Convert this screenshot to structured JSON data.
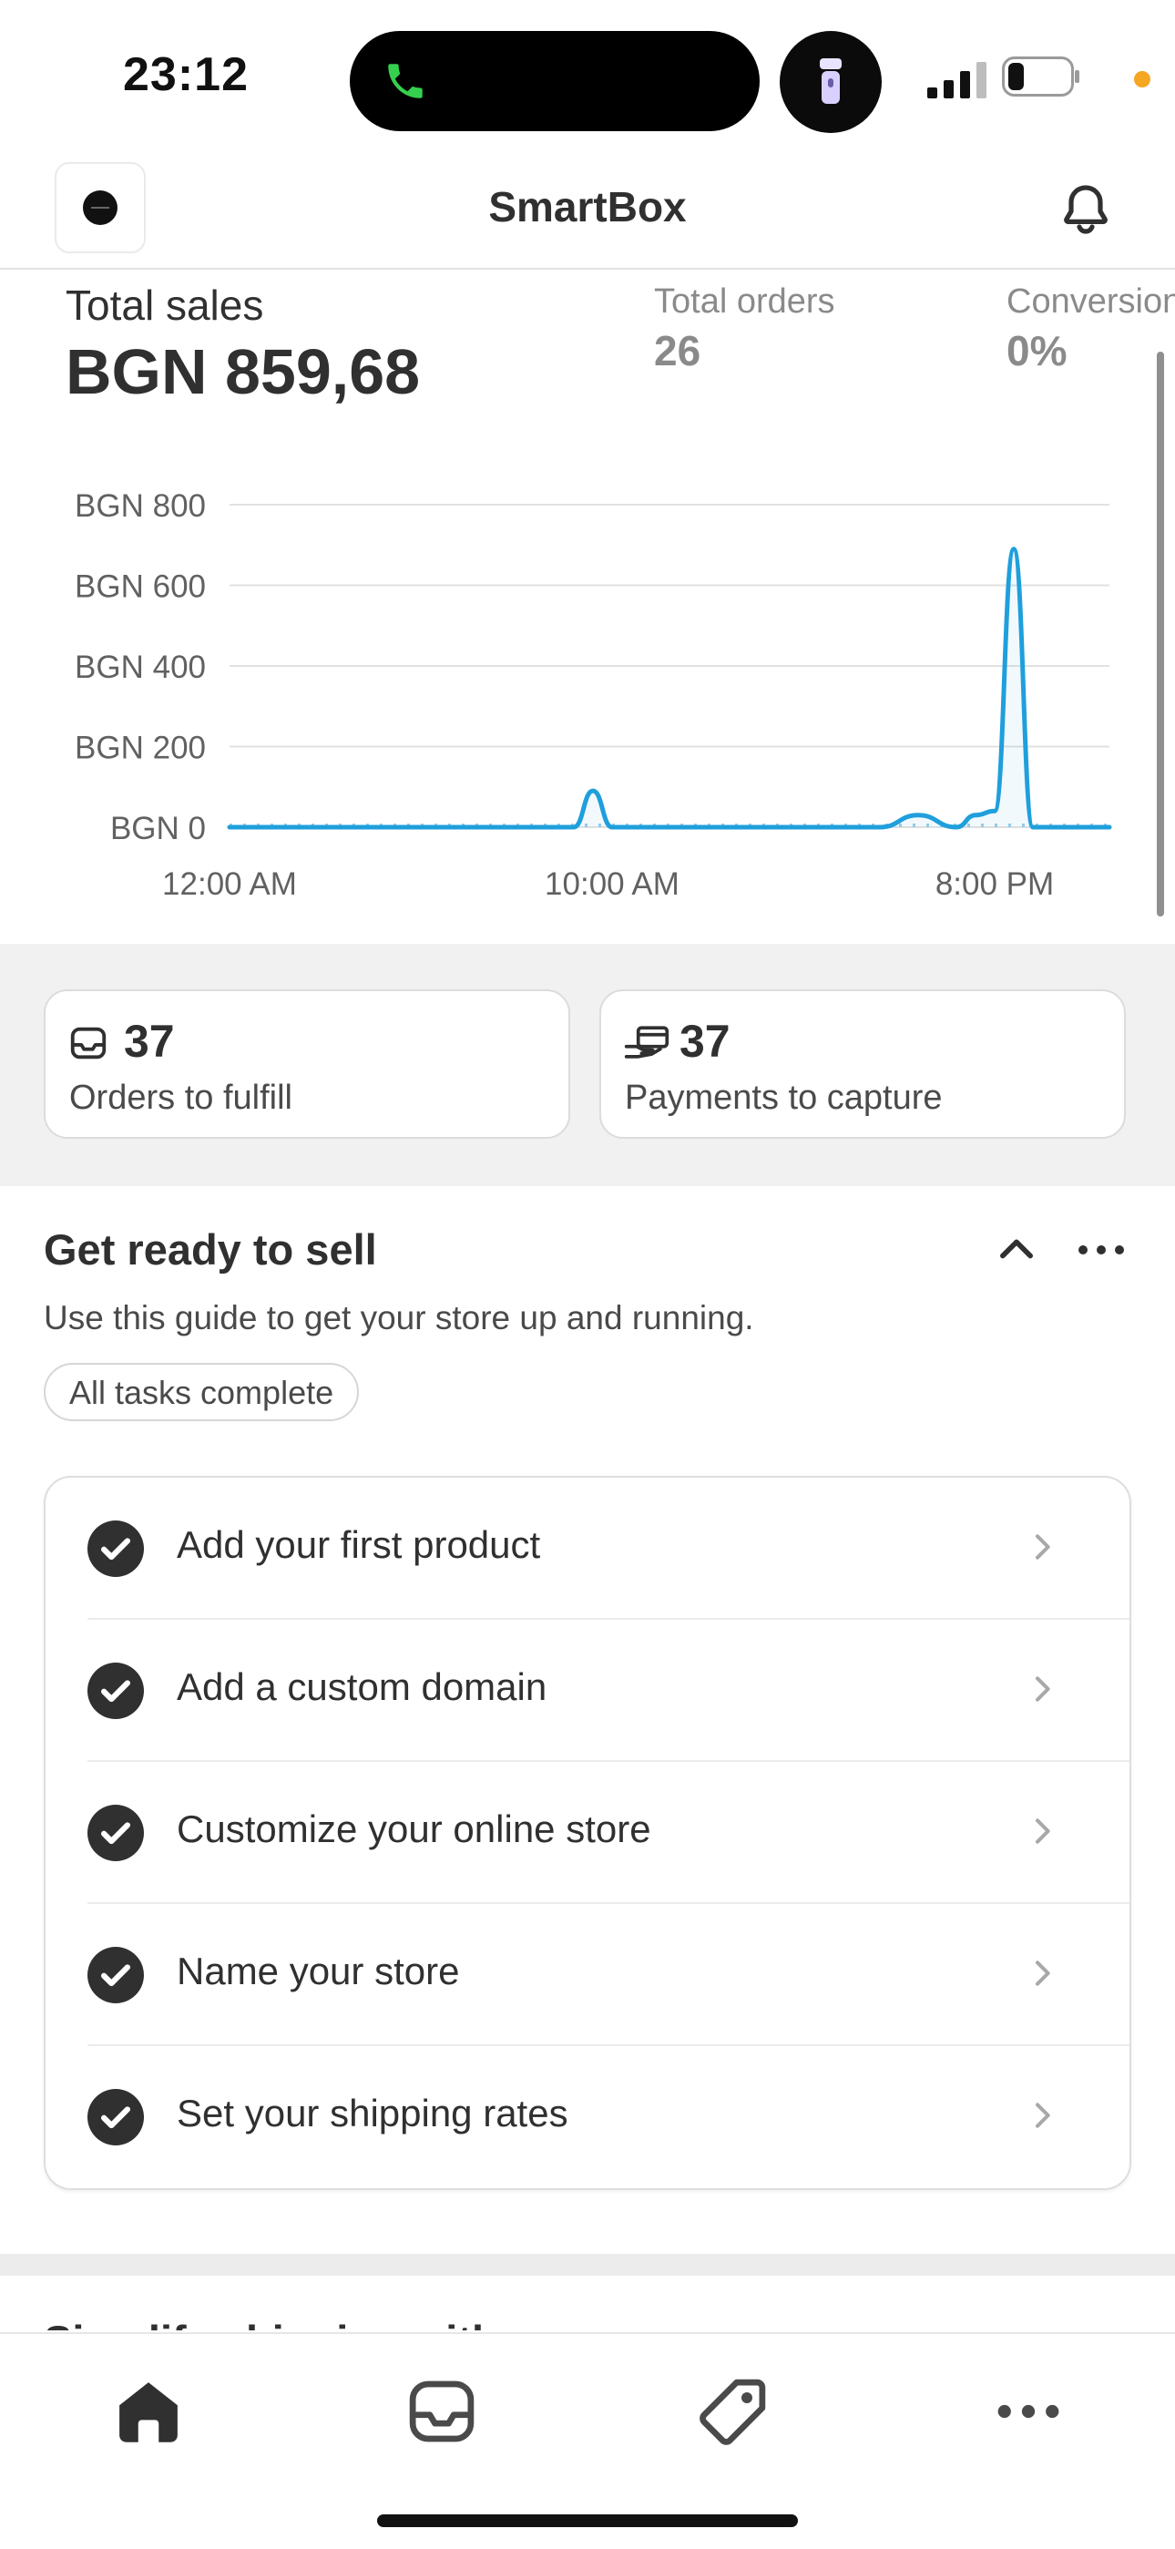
{
  "status_bar": {
    "time": "23:12",
    "battery_level": 0.25
  },
  "header": {
    "title": "SmartBox",
    "logo_icon": "store-logo",
    "notification_icon": "bell-icon"
  },
  "metrics": {
    "total_sales_label": "Total sales",
    "total_sales_value": "BGN 859,68",
    "total_orders_label": "Total orders",
    "total_orders_value": "26",
    "conversion_label": "Conversion",
    "conversion_value": "0%"
  },
  "chart_data": {
    "type": "line",
    "y_ticks": [
      "BGN 800",
      "BGN 600",
      "BGN 400",
      "BGN 200",
      "BGN 0"
    ],
    "y_tick_values": [
      800,
      600,
      400,
      200,
      0
    ],
    "x_ticks": [
      "12:00 AM",
      "10:00 AM",
      "8:00 PM"
    ],
    "x_tick_hours": [
      0,
      10,
      20
    ],
    "xlim": [
      0,
      23
    ],
    "ylim": [
      0,
      800
    ],
    "grid": true,
    "series": [
      {
        "color": "#1f9fdc",
        "x": [
          0,
          8,
          9,
          9.5,
          10,
          11,
          17,
          18,
          19,
          19.5,
          20,
          20.5,
          21,
          22,
          23
        ],
        "y": [
          0,
          0,
          0,
          90,
          0,
          0,
          0,
          30,
          0,
          30,
          40,
          690,
          0,
          0,
          0
        ]
      }
    ]
  },
  "cards": [
    {
      "icon": "inbox-icon",
      "count": "37",
      "label": "Orders to fulfill"
    },
    {
      "icon": "hand-card-icon",
      "count": "37",
      "label": "Payments to capture"
    }
  ],
  "guide": {
    "title": "Get ready to sell",
    "description": "Use this guide to get your store up and running.",
    "status_pill": "All tasks complete",
    "tasks": [
      {
        "label": "Add your first product"
      },
      {
        "label": "Add a custom domain"
      },
      {
        "label": "Customize your online store"
      },
      {
        "label": "Name your store"
      },
      {
        "label": "Set your shipping rates"
      }
    ]
  },
  "next_section": {
    "title": "Simplify shipping with"
  },
  "tabbar": {
    "tabs": [
      {
        "name": "home",
        "icon": "home-icon",
        "active": true
      },
      {
        "name": "orders",
        "icon": "inbox-icon"
      },
      {
        "name": "products",
        "icon": "tag-icon"
      },
      {
        "name": "more",
        "icon": "more-icon"
      }
    ]
  },
  "colors": {
    "accent": "#1f9fdc",
    "text": "#303030",
    "muted": "#8a8a8a"
  }
}
